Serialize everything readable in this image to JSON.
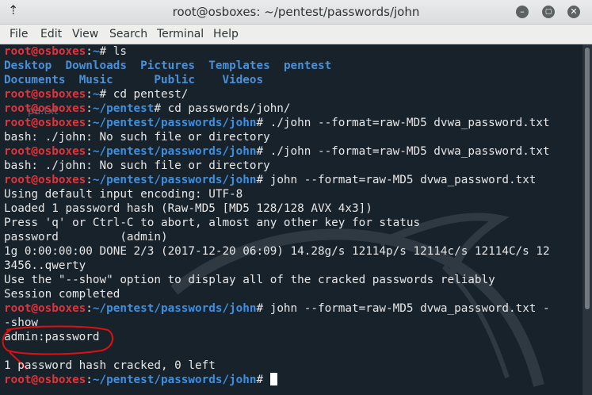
{
  "window": {
    "title": "root@osboxes: ~/pentest/passwords/john"
  },
  "menu": {
    "items": [
      "File",
      "Edit",
      "View",
      "Search",
      "Terminal",
      "Help"
    ]
  },
  "colors": {
    "prompt_user": "#e0343d",
    "prompt_path": "#3f8fe0",
    "directory": "#4a90d9",
    "text": "#e7e7e7",
    "background": "#18222b"
  },
  "terminal": {
    "prompt_user": "root@osboxes",
    "home_path": "~",
    "pentest_path": "~/pentest",
    "john_path": "~/pentest/passwords/john",
    "lines": {
      "cmd1": "# ls",
      "ls_row1": [
        "Desktop",
        "Downloads",
        "Pictures",
        "Templates",
        "pentest"
      ],
      "ls_row2": [
        "Documents",
        "Music",
        "Public",
        "Videos"
      ],
      "cmd2": "# cd pentest/",
      "cmd3": "# cd passwords/john/",
      "cmd4": "# ./john --format=raw-MD5 dvwa_password.txt",
      "err1": "bash: ./john: No such file or directory",
      "cmd5": "# ./john --format=raw-MD5 dvwa_password.txt",
      "err2": "bash: ./john: No such file or directory",
      "cmd6": "# john --format=raw-MD5 dvwa_password.txt",
      "out1": "Using default input encoding: UTF-8",
      "out2": "Loaded 1 password hash (Raw-MD5 [MD5 128/128 AVX 4x3])",
      "out3": "Press 'q' or Ctrl-C to abort, almost any other key for status",
      "out4": "password         (admin)",
      "out5": "1g 0:00:00:00 DONE 2/3 (2017-12-20 06:09) 14.28g/s 12114p/s 12114c/s 12114C/s 12",
      "out6": "3456..qwerty",
      "out7": "Use the \"--show\" option to display all of the cracked passwords reliably",
      "out8": "Session completed",
      "cmd7": "# john --format=raw-MD5 dvwa_password.txt -",
      "cmd7b": "-show",
      "out9": "admin:password",
      "out10": "1 password hash cracked, 0 left",
      "prompt_end": "#"
    },
    "ghost_text": "pa.txt"
  }
}
